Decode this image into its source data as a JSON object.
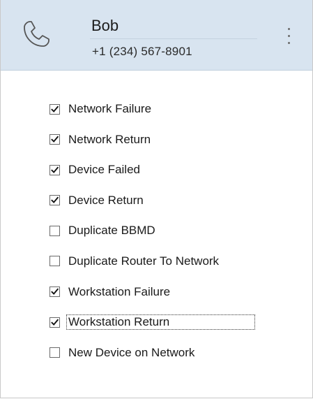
{
  "contact": {
    "name": "Bob",
    "phone": "+1 (234) 567-8901"
  },
  "icons": {
    "phone": "phone-icon",
    "more": "more-vertical-icon",
    "check": "checkmark-icon"
  },
  "colors": {
    "header_bg": "#d8e4f0",
    "text": "#1a1a1a"
  },
  "notifications": [
    {
      "label": "Network Failure",
      "checked": true
    },
    {
      "label": "Network Return",
      "checked": true
    },
    {
      "label": "Device Failed",
      "checked": true
    },
    {
      "label": "Device Return",
      "checked": true
    },
    {
      "label": "Duplicate BBMD",
      "checked": false
    },
    {
      "label": "Duplicate Router To Network",
      "checked": false
    },
    {
      "label": "Workstation Failure",
      "checked": true
    },
    {
      "label": "Workstation Return",
      "checked": true,
      "focused": true
    },
    {
      "label": "New Device on Network",
      "checked": false
    }
  ]
}
